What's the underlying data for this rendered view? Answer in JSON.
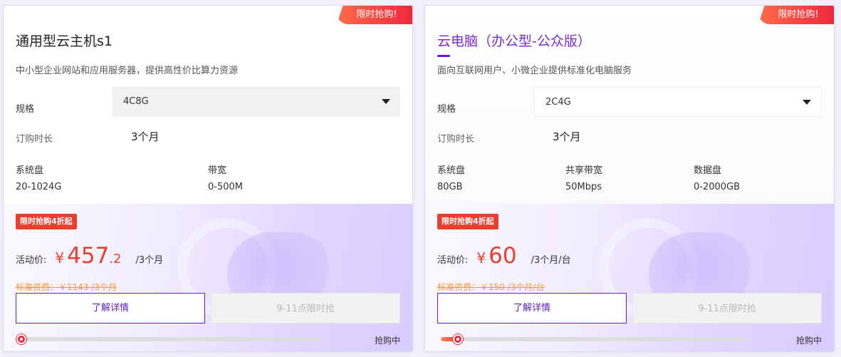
{
  "cards": [
    {
      "badge": "限时抢购!",
      "title": "通用型云主机s1",
      "description": "中小型企业网站和应用服务器，提供高性价比算力资源",
      "spec_label": "规格",
      "spec_value": "4C8G",
      "duration_label": "订购时长",
      "duration_value": "3个月",
      "specs": [
        {
          "k": "系统盘",
          "v": "20-1024G"
        },
        {
          "k": "带宽",
          "v": "0-500M"
        }
      ],
      "promo_tag": "限时抢购4折起",
      "price_label": "活动价:",
      "currency": "¥",
      "price_int": "457",
      "price_dec": ".2",
      "price_unit": "/3个月",
      "original_price": "标准资费：￥1143 /3个月",
      "detail_button": "了解详情",
      "buy_button": "9-11点限时抢",
      "progress": 0.0,
      "status": "抢购中"
    },
    {
      "badge": "限时抢购!",
      "title": "云电脑（办公型-公众版）",
      "description": "面向互联网用户、小微企业提供标准化电脑服务",
      "spec_label": "规格",
      "spec_value": "2C4G",
      "duration_label": "订购时长",
      "duration_value": "3个月",
      "specs": [
        {
          "k": "系统盘",
          "v": "80GB"
        },
        {
          "k": "共享带宽",
          "v": "50Mbps"
        },
        {
          "k": "数据盘",
          "v": "0-2000GB"
        }
      ],
      "promo_tag": "限时抢购4折起",
      "price_label": "活动价:",
      "currency": "¥",
      "price_int": "60",
      "price_dec": "",
      "price_unit": "/3个月/台",
      "original_price": "标准资费：￥150 /3个月/台",
      "detail_button": "了解详情",
      "buy_button": "9-11点限时抢",
      "progress": 0.05,
      "status": "抢购中"
    }
  ],
  "colors": {
    "accent_purple": "#6a1bd0",
    "price_red": "#e8402e",
    "badge_red": "#f0283c",
    "original_orange": "#f59a3a"
  },
  "icons": [
    "chevron-down-icon",
    "flame-icon"
  ]
}
